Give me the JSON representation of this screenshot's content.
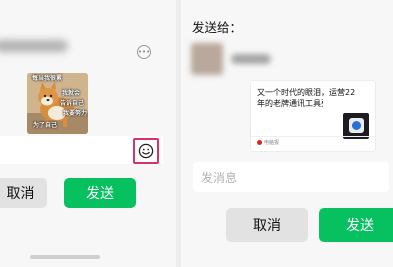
{
  "left_dialog": {
    "more_icon": "ellipsis-circle-icon",
    "sticker": {
      "captions": [
        "每当我很累",
        "我就会",
        "告诉自己",
        "我要努力",
        "为了自己"
      ]
    },
    "emoji_icon": "smiley-face-icon",
    "cancel_label": "取消",
    "send_label": "发送",
    "highlight_color": "#d9316a"
  },
  "right_dialog": {
    "send_to_label": "发送给：",
    "link_card": {
      "title_line1": "又一个时代的眼泪，运营22",
      "title_line2": "年的老牌通讯工具要关停了",
      "source": "电脑报",
      "thumbnail_icon": "app-logo-icon"
    },
    "message_input": {
      "placeholder": "发消息"
    },
    "cancel_label": "取消",
    "send_label": "发送"
  },
  "colors": {
    "send_green": "#07c160",
    "cancel_gray": "#e2e2e2",
    "background": "#ededed"
  }
}
